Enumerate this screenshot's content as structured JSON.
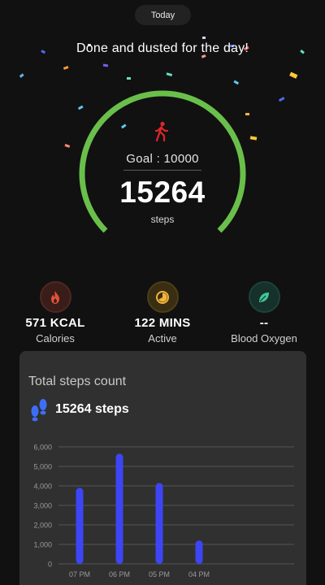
{
  "header": {
    "date_tab": "Today",
    "headline": "Done and dusted for the day!"
  },
  "ring": {
    "goal_label": "Goal : 10000",
    "steps_value": "15264",
    "steps_unit": "steps",
    "progress": 1.0,
    "color": "#6abf4b",
    "icon": "walking-person-icon",
    "icon_color": "#e0262b"
  },
  "stats": [
    {
      "value": "571 KCAL",
      "label": "Calories",
      "icon": "flame-icon",
      "color": "#e0523a"
    },
    {
      "value": "122 MINS",
      "label": "Active",
      "icon": "timer-icon",
      "color": "#f0b53a"
    },
    {
      "value": "--",
      "label": "Blood Oxygen",
      "icon": "leaf-icon",
      "color": "#3fc79a"
    }
  ],
  "card": {
    "title": "Total steps count",
    "steps_text": "15264 steps",
    "icon": "footsteps-icon",
    "bar_color": "#3d45f5"
  },
  "chart_data": {
    "type": "bar",
    "categories": [
      "07 PM",
      "06 PM",
      "05 PM",
      "04 PM"
    ],
    "values": [
      3900,
      5650,
      4150,
      1200
    ],
    "ylim": [
      0,
      6000
    ],
    "yticks": [
      0,
      1000,
      2000,
      3000,
      4000,
      5000,
      6000
    ],
    "ytick_labels": [
      "0",
      "1,000",
      "2,000",
      "3,000",
      "4,000",
      "5,000",
      "6,000"
    ],
    "grid": true,
    "title": "",
    "xlabel": "",
    "ylabel": ""
  }
}
